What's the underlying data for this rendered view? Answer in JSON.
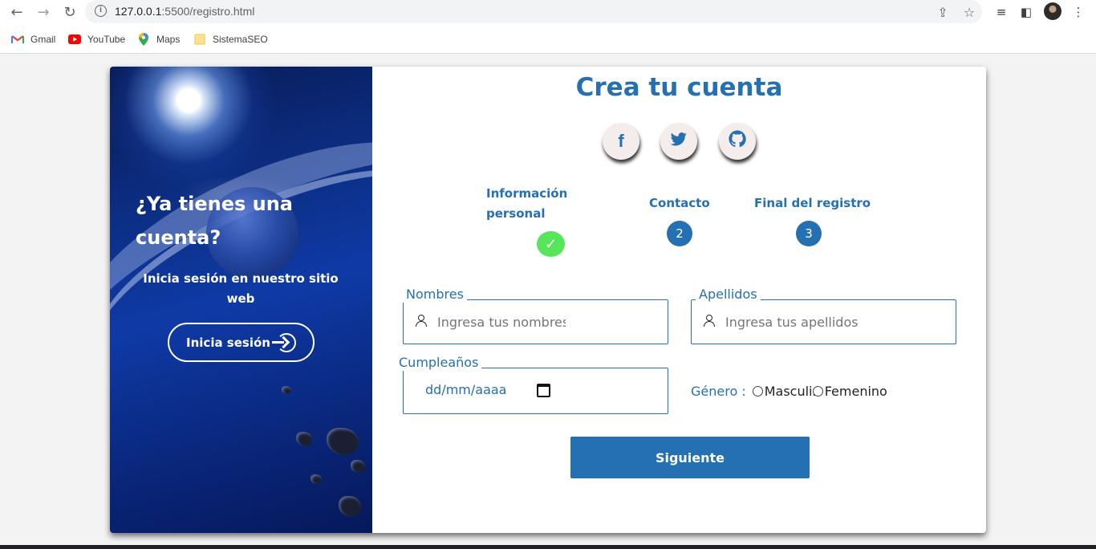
{
  "browser": {
    "url_host": "127.0.0.1",
    "url_path": ":5500/registro.html",
    "bookmarks": [
      {
        "label": "Gmail",
        "icon": "gmail-icon"
      },
      {
        "label": "YouTube",
        "icon": "youtube-icon"
      },
      {
        "label": "Maps",
        "icon": "maps-icon"
      },
      {
        "label": "SistemaSEO",
        "icon": "folder-icon"
      }
    ]
  },
  "sidebar": {
    "title": "¿Ya tienes una cuenta?",
    "subtitle": "Inicia sesión en nuestro sitio web",
    "login_label": "Inicia sesión"
  },
  "form": {
    "title": "Crea tu cuenta",
    "social": [
      {
        "icon": "facebook-icon",
        "glyph": "f"
      },
      {
        "icon": "twitter-icon",
        "glyph": "🐦"
      },
      {
        "icon": "github-icon",
        "glyph": "⌾"
      }
    ],
    "steps": [
      {
        "label": "Información personal",
        "status": "done",
        "marker": "✓"
      },
      {
        "label": "Contacto",
        "status": "pending",
        "marker": "2"
      },
      {
        "label": "Final del registro",
        "status": "pending",
        "marker": "3"
      }
    ],
    "fields": {
      "nombres": {
        "label": "Nombres",
        "placeholder": "Ingresa tus nombres"
      },
      "apellidos": {
        "label": "Apellidos",
        "placeholder": "Ingresa tus apellidos"
      },
      "cumpleanos": {
        "label": "Cumpleaños",
        "placeholder": "dd/mm/aaaa"
      }
    },
    "gender": {
      "label": "Género :",
      "options": [
        "Masculino",
        "Femenino"
      ]
    },
    "submit_label": "Siguiente"
  },
  "colors": {
    "accent": "#2570b3",
    "done": "#55e65a"
  }
}
